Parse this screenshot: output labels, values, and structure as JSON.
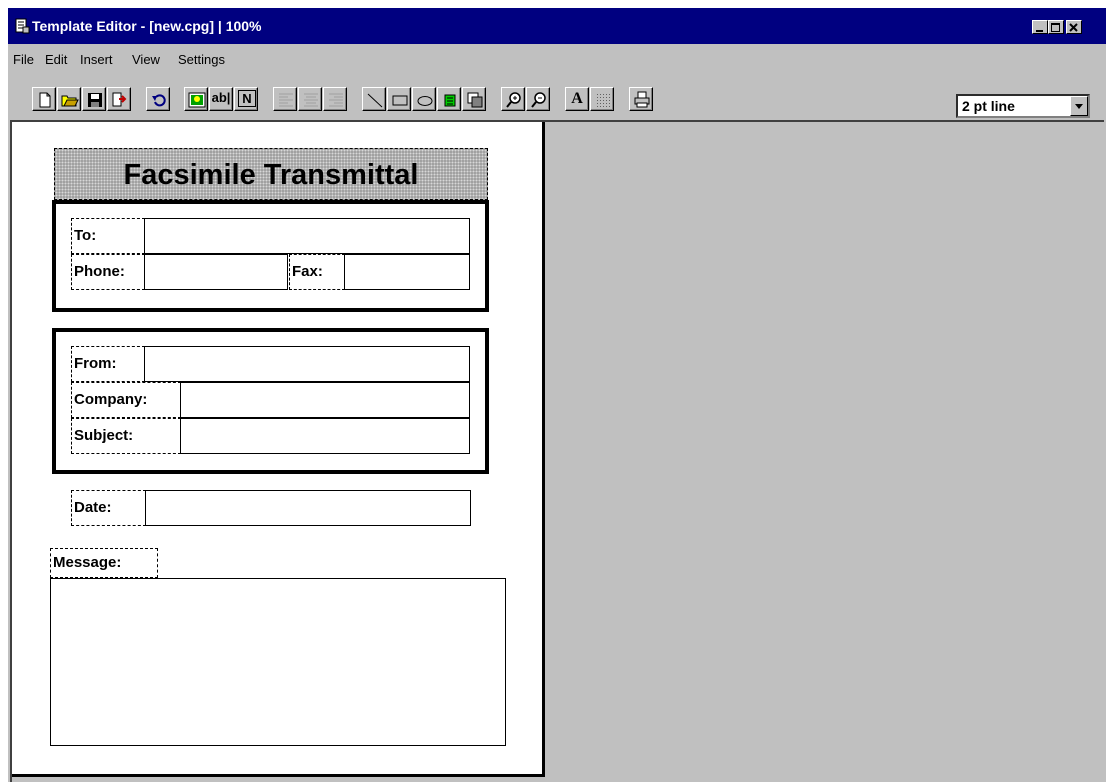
{
  "window": {
    "title": "Template Editor - [new.cpg] | 100%"
  },
  "menu": [
    "File",
    "Edit",
    "Insert",
    "View",
    "Settings"
  ],
  "toolbar": {
    "buttons": [
      "new-file-icon",
      "open-folder-icon",
      "save-icon",
      "exit-icon",
      "undo-icon",
      "insert-picture-icon",
      "text-field-button",
      "number-field-button",
      "align-left-icon",
      "align-center-icon",
      "align-right-icon",
      "line-tool-icon",
      "rectangle-tool-icon",
      "ellipse-tool-icon",
      "fill-color-icon",
      "bring-front-icon",
      "zoom-in-icon",
      "zoom-out-icon",
      "font-button",
      "shading-button",
      "print-icon"
    ],
    "text_field_label": "ab|",
    "number_field_label": "N",
    "font_label": "A",
    "line_width": {
      "value": "2 pt line"
    }
  },
  "template": {
    "banner_title": "Facsimile Transmittal",
    "to_label": "To:",
    "phone_label": "Phone:",
    "fax_label": "Fax:",
    "from_label": "From:",
    "company_label": "Company:",
    "subject_label": "Subject:",
    "date_label": "Date:",
    "message_label": "Message:"
  },
  "colors": {
    "title_bar": "#000080",
    "chrome": "#c0c0c0",
    "highlight_green": "#00cc00"
  }
}
